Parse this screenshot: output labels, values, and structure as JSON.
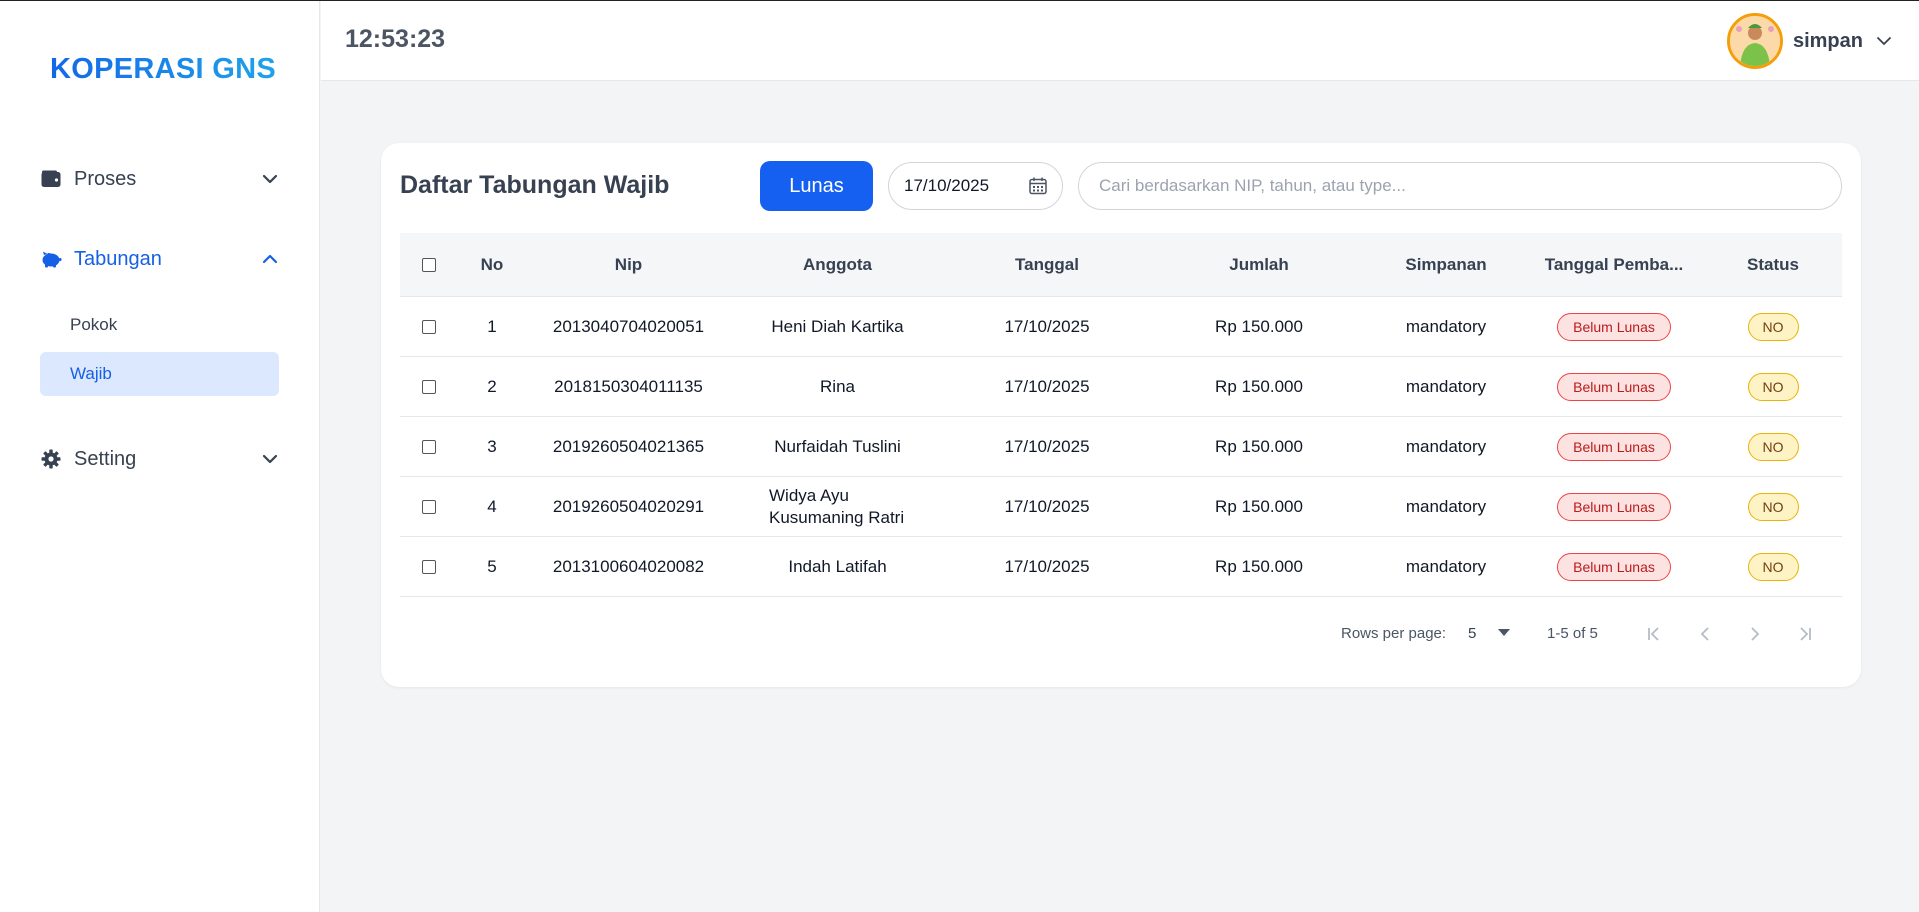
{
  "brand": "KOPERASI GNS",
  "topbar": {
    "clock": "12:53:23",
    "username": "simpan"
  },
  "sidebar": {
    "proses": "Proses",
    "tabungan": "Tabungan",
    "pokok": "Pokok",
    "wajib": "Wajib",
    "setting": "Setting"
  },
  "colors": {
    "accent": "#1560f0",
    "active_bg": "#dbe8fd",
    "danger": "#ef4444",
    "warning": "#eab308"
  },
  "card": {
    "title": "Daftar Tabungan Wajib",
    "lunas_button": "Lunas",
    "date_value": "17/10/2025",
    "search_placeholder": "Cari berdasarkan NIP, tahun, atau type..."
  },
  "table": {
    "headers": {
      "no": "No",
      "nip": "Nip",
      "anggota": "Anggota",
      "tanggal": "Tanggal",
      "jumlah": "Jumlah",
      "simpanan": "Simpanan",
      "tanggal_bayar": "Tanggal Pemba...",
      "status": "Status"
    },
    "rows": [
      {
        "no": "1",
        "nip": "2013040704020051",
        "anggota": "Heni Diah Kartika",
        "tanggal": "17/10/2025",
        "jumlah": "Rp 150.000",
        "simpanan": "mandatory",
        "tanggal_bayar": "Belum Lunas",
        "status": "NO"
      },
      {
        "no": "2",
        "nip": "2018150304011135",
        "anggota": "Rina",
        "tanggal": "17/10/2025",
        "jumlah": "Rp 150.000",
        "simpanan": "mandatory",
        "tanggal_bayar": "Belum Lunas",
        "status": "NO"
      },
      {
        "no": "3",
        "nip": "2019260504021365",
        "anggota": "Nurfaidah Tuslini",
        "tanggal": "17/10/2025",
        "jumlah": "Rp 150.000",
        "simpanan": "mandatory",
        "tanggal_bayar": "Belum Lunas",
        "status": "NO"
      },
      {
        "no": "4",
        "nip": "2019260504020291",
        "anggota": "Widya Ayu Kusumaning Ratri",
        "tanggal": "17/10/2025",
        "jumlah": "Rp 150.000",
        "simpanan": "mandatory",
        "tanggal_bayar": "Belum Lunas",
        "status": "NO"
      },
      {
        "no": "5",
        "nip": "2013100604020082",
        "anggota": "Indah Latifah",
        "tanggal": "17/10/2025",
        "jumlah": "Rp 150.000",
        "simpanan": "mandatory",
        "tanggal_bayar": "Belum Lunas",
        "status": "NO"
      }
    ]
  },
  "pagination": {
    "rows_per_page_label": "Rows per page:",
    "rows_per_page": "5",
    "range": "1-5 of 5"
  }
}
